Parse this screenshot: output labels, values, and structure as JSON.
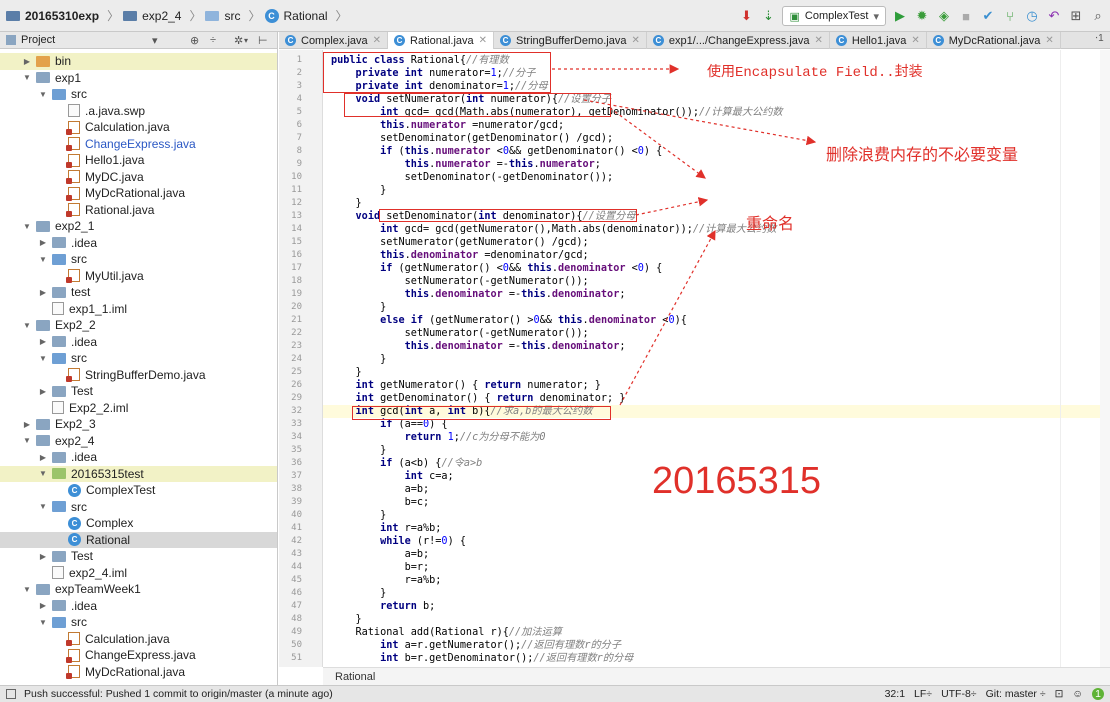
{
  "breadcrumb": [
    "20165310exp",
    "exp2_4",
    "src",
    "Rational"
  ],
  "toolbar": {
    "run_config": "ComplexTest"
  },
  "project": {
    "title": "Project",
    "items": [
      {
        "label": "bin",
        "type": "dir-orange",
        "depth": 1,
        "arrow": "right",
        "hl": true
      },
      {
        "label": "exp1",
        "type": "dir",
        "depth": 1,
        "arrow": "down"
      },
      {
        "label": "src",
        "type": "src",
        "depth": 2,
        "arrow": "down"
      },
      {
        "label": ".a.java.swp",
        "type": "file",
        "depth": 3
      },
      {
        "label": "Calculation.java",
        "type": "java",
        "depth": 3
      },
      {
        "label": "ChangeExpress.java",
        "type": "java",
        "depth": 3,
        "blue": true
      },
      {
        "label": "Hello1.java",
        "type": "java",
        "depth": 3
      },
      {
        "label": "MyDC.java",
        "type": "java",
        "depth": 3
      },
      {
        "label": "MyDcRational.java",
        "type": "java",
        "depth": 3
      },
      {
        "label": "Rational.java",
        "type": "java",
        "depth": 3
      },
      {
        "label": "exp2_1",
        "type": "dir",
        "depth": 1,
        "arrow": "down"
      },
      {
        "label": ".idea",
        "type": "dir",
        "depth": 2,
        "arrow": "right"
      },
      {
        "label": "src",
        "type": "src",
        "depth": 2,
        "arrow": "down"
      },
      {
        "label": "MyUtil.java",
        "type": "java",
        "depth": 3
      },
      {
        "label": "test",
        "type": "dir",
        "depth": 2,
        "arrow": "right"
      },
      {
        "label": "exp1_1.iml",
        "type": "file",
        "depth": 2
      },
      {
        "label": "Exp2_2",
        "type": "dir",
        "depth": 1,
        "arrow": "down"
      },
      {
        "label": ".idea",
        "type": "dir",
        "depth": 2,
        "arrow": "right"
      },
      {
        "label": "src",
        "type": "src",
        "depth": 2,
        "arrow": "down"
      },
      {
        "label": "StringBufferDemo.java",
        "type": "java",
        "depth": 3
      },
      {
        "label": "Test",
        "type": "dir",
        "depth": 2,
        "arrow": "right"
      },
      {
        "label": "Exp2_2.iml",
        "type": "file",
        "depth": 2
      },
      {
        "label": "Exp2_3",
        "type": "dir",
        "depth": 1,
        "arrow": "right"
      },
      {
        "label": "exp2_4",
        "type": "dir",
        "depth": 1,
        "arrow": "down"
      },
      {
        "label": ".idea",
        "type": "dir",
        "depth": 2,
        "arrow": "right"
      },
      {
        "label": "20165315test",
        "type": "dir-green",
        "depth": 2,
        "arrow": "down",
        "hl": true
      },
      {
        "label": "ComplexTest",
        "type": "class",
        "depth": 3
      },
      {
        "label": "src",
        "type": "src",
        "depth": 2,
        "arrow": "down"
      },
      {
        "label": "Complex",
        "type": "class",
        "depth": 3
      },
      {
        "label": "Rational",
        "type": "class",
        "depth": 3,
        "selected": true
      },
      {
        "label": "Test",
        "type": "dir",
        "depth": 2,
        "arrow": "right"
      },
      {
        "label": "exp2_4.iml",
        "type": "file",
        "depth": 2
      },
      {
        "label": "expTeamWeek1",
        "type": "dir",
        "depth": 1,
        "arrow": "down"
      },
      {
        "label": ".idea",
        "type": "dir",
        "depth": 2,
        "arrow": "right"
      },
      {
        "label": "src",
        "type": "src",
        "depth": 2,
        "arrow": "down"
      },
      {
        "label": "Calculation.java",
        "type": "java",
        "depth": 3
      },
      {
        "label": "ChangeExpress.java",
        "type": "java",
        "depth": 3
      },
      {
        "label": "MyDcRational.java",
        "type": "java",
        "depth": 3
      }
    ]
  },
  "tabs": [
    {
      "label": "Complex.java",
      "active": false
    },
    {
      "label": "Rational.java",
      "active": true
    },
    {
      "label": "StringBufferDemo.java",
      "active": false
    },
    {
      "label": "exp1/.../ChangeExpress.java",
      "active": false
    },
    {
      "label": "Hello1.java",
      "active": false
    },
    {
      "label": "MyDcRational.java",
      "active": false
    }
  ],
  "code_lines": [
    {
      "n": 1,
      "t": "public class Rational{//有理数"
    },
    {
      "n": 2,
      "t": "    private int numerator=1;//分子"
    },
    {
      "n": 3,
      "t": "    private int denominator=1;//分母"
    },
    {
      "n": 4,
      "t": "    void setNumerator(int numerator){//设置分子"
    },
    {
      "n": 5,
      "t": "        int gcd= gcd(Math.abs(numerator), getDenominator());//计算最大公约数"
    },
    {
      "n": 6,
      "t": "        this.numerator =numerator/gcd;"
    },
    {
      "n": 7,
      "t": "        setDenominator(getDenominator() /gcd);"
    },
    {
      "n": 8,
      "t": "        if (this.numerator <0&& getDenominator() <0) {"
    },
    {
      "n": 9,
      "t": "            this.numerator =-this.numerator;"
    },
    {
      "n": 10,
      "t": "            setDenominator(-getDenominator());"
    },
    {
      "n": 11,
      "t": "        }"
    },
    {
      "n": 12,
      "t": "    }"
    },
    {
      "n": 13,
      "t": "    void setDenominator(int denominator){//设置分母"
    },
    {
      "n": 14,
      "t": "        int gcd= gcd(getNumerator(),Math.abs(denominator));//计算最大公约数"
    },
    {
      "n": 15,
      "t": "        setNumerator(getNumerator() /gcd);"
    },
    {
      "n": 16,
      "t": "        this.denominator =denominator/gcd;"
    },
    {
      "n": 17,
      "t": "        if (getNumerator() <0&& this.denominator <0) {"
    },
    {
      "n": 18,
      "t": "            setNumerator(-getNumerator());"
    },
    {
      "n": 19,
      "t": "            this.denominator =-this.denominator;"
    },
    {
      "n": 20,
      "t": "        }"
    },
    {
      "n": 21,
      "t": "        else if (getNumerator() >0&& this.denominator <0){"
    },
    {
      "n": 22,
      "t": "            setNumerator(-getNumerator());"
    },
    {
      "n": 23,
      "t": "            this.denominator =-this.denominator;"
    },
    {
      "n": 24,
      "t": "        }"
    },
    {
      "n": 25,
      "t": "    }"
    },
    {
      "n": 26,
      "t": "    int getNumerator() { return numerator; }"
    },
    {
      "n": 29,
      "t": "    int getDenominator() { return denominator; }"
    },
    {
      "n": 32,
      "t": "    int gcd(int a, int b){//求a,b的最大公约数"
    },
    {
      "n": 33,
      "t": "        if (a==0) {"
    },
    {
      "n": 34,
      "t": "            return 1;//c为分母不能为0"
    },
    {
      "n": 35,
      "t": "        }"
    },
    {
      "n": 36,
      "t": "        if (a<b) {//令a>b"
    },
    {
      "n": 37,
      "t": "            int c=a;"
    },
    {
      "n": 38,
      "t": "            a=b;"
    },
    {
      "n": 39,
      "t": "            b=c;"
    },
    {
      "n": 40,
      "t": "        }"
    },
    {
      "n": 41,
      "t": "        int r=a%b;"
    },
    {
      "n": 42,
      "t": "        while (r!=0) {"
    },
    {
      "n": 43,
      "t": "            a=b;"
    },
    {
      "n": 44,
      "t": "            b=r;"
    },
    {
      "n": 45,
      "t": "            r=a%b;"
    },
    {
      "n": 46,
      "t": "        }"
    },
    {
      "n": 47,
      "t": "        return b;"
    },
    {
      "n": 48,
      "t": "    }"
    },
    {
      "n": 49,
      "t": "    Rational add(Rational r){//加法运算"
    },
    {
      "n": 50,
      "t": "        int a=r.getNumerator();//返回有理数r的分子"
    },
    {
      "n": 51,
      "t": "        int b=r.getDenominator();//返回有理数r的分母"
    }
  ],
  "annotations": {
    "encapsulate": "使用Encapsulate Field..封装",
    "remove_var": "删除浪费内存的不必要变量",
    "rename": "重命名",
    "student_id": "20165315"
  },
  "editor_breadcrumb": "Rational",
  "status": {
    "message": "Push successful: Pushed 1 commit to origin/master (a minute ago)",
    "position": "32:1",
    "line_sep": "LF÷",
    "encoding": "UTF-8÷",
    "git": "Git: master ÷"
  },
  "colors": {
    "annotation": "#e0302a",
    "keyword": "#000080",
    "field": "#660e7a",
    "comment": "#808080"
  }
}
